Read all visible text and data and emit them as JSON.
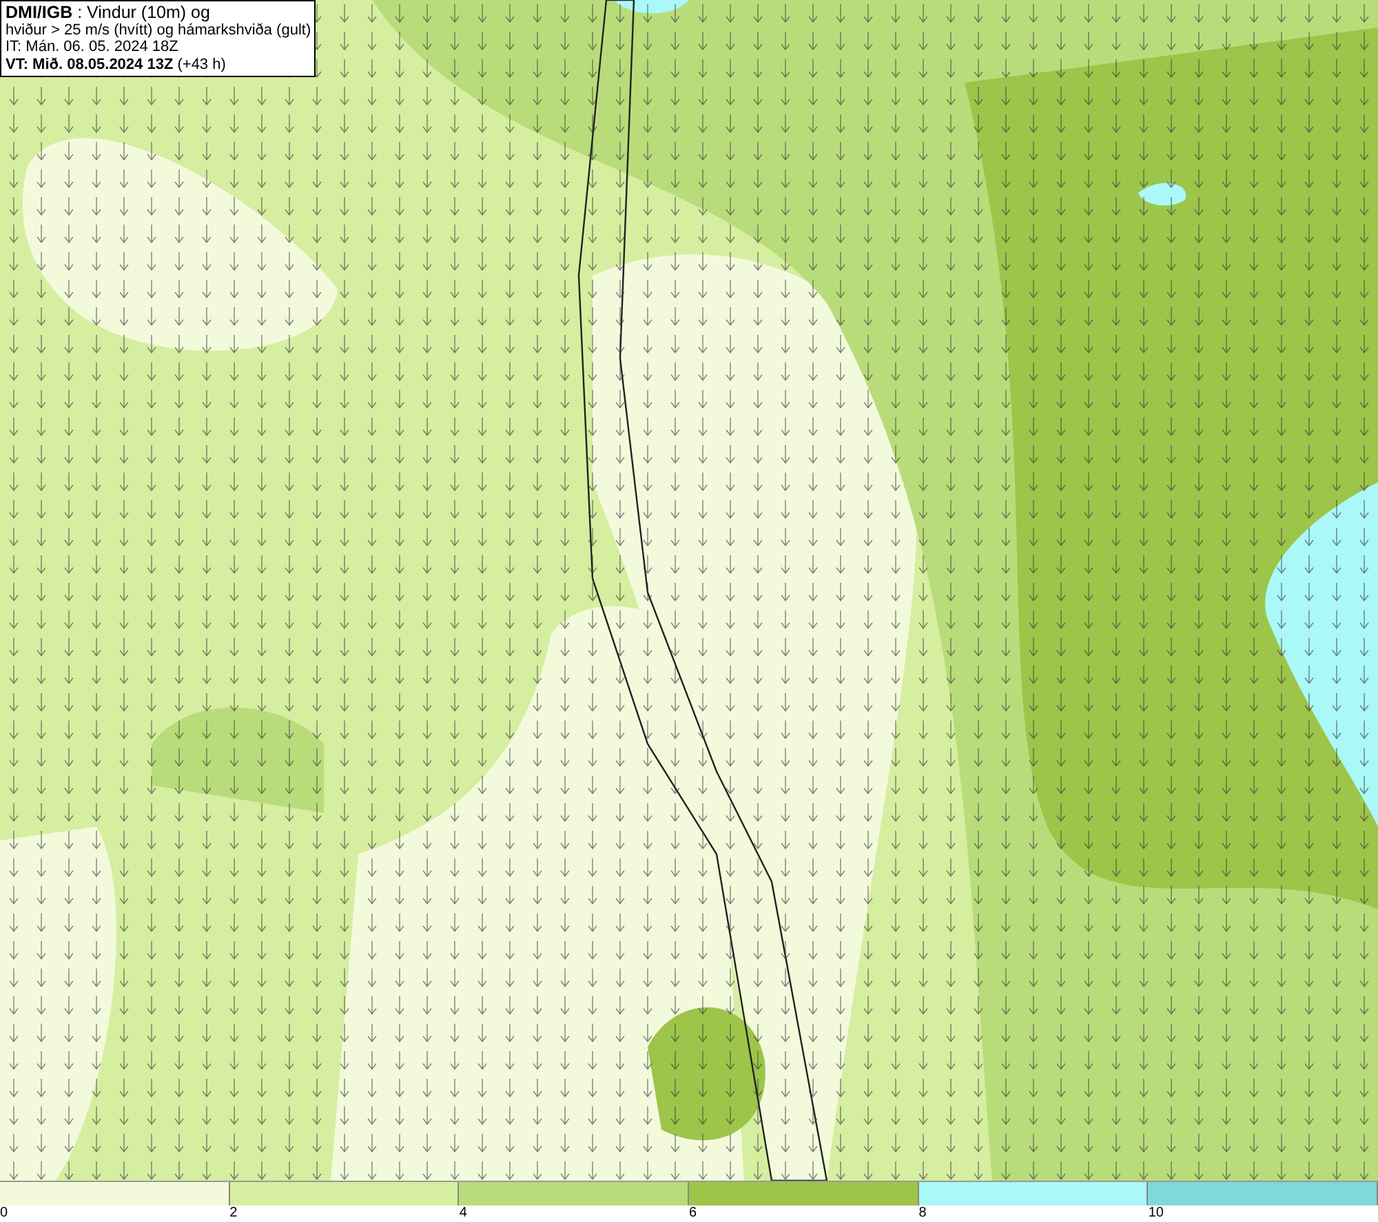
{
  "info_box": {
    "lines": [
      "**DMI/IGB** : Vindur (10m) og",
      "hviður > 25 m/s (hvítt) og hámarkshviða (gult)",
      "IT: Mán. 06. 05. 2024 18Z",
      "**VT: Mið. 08.05.2024 13Z** (+43 h)"
    ]
  },
  "colorbar": {
    "segments": [
      {
        "color": "#f3fadc"
      },
      {
        "color": "#d6eea0"
      },
      {
        "color": "#b9dc7a"
      },
      {
        "color": "#9cc54a"
      },
      {
        "color": "#aaf8f8"
      },
      {
        "color": "#80d8d8"
      }
    ],
    "ticks": [
      "0",
      "2",
      "4",
      "6",
      "8",
      "10"
    ]
  }
}
